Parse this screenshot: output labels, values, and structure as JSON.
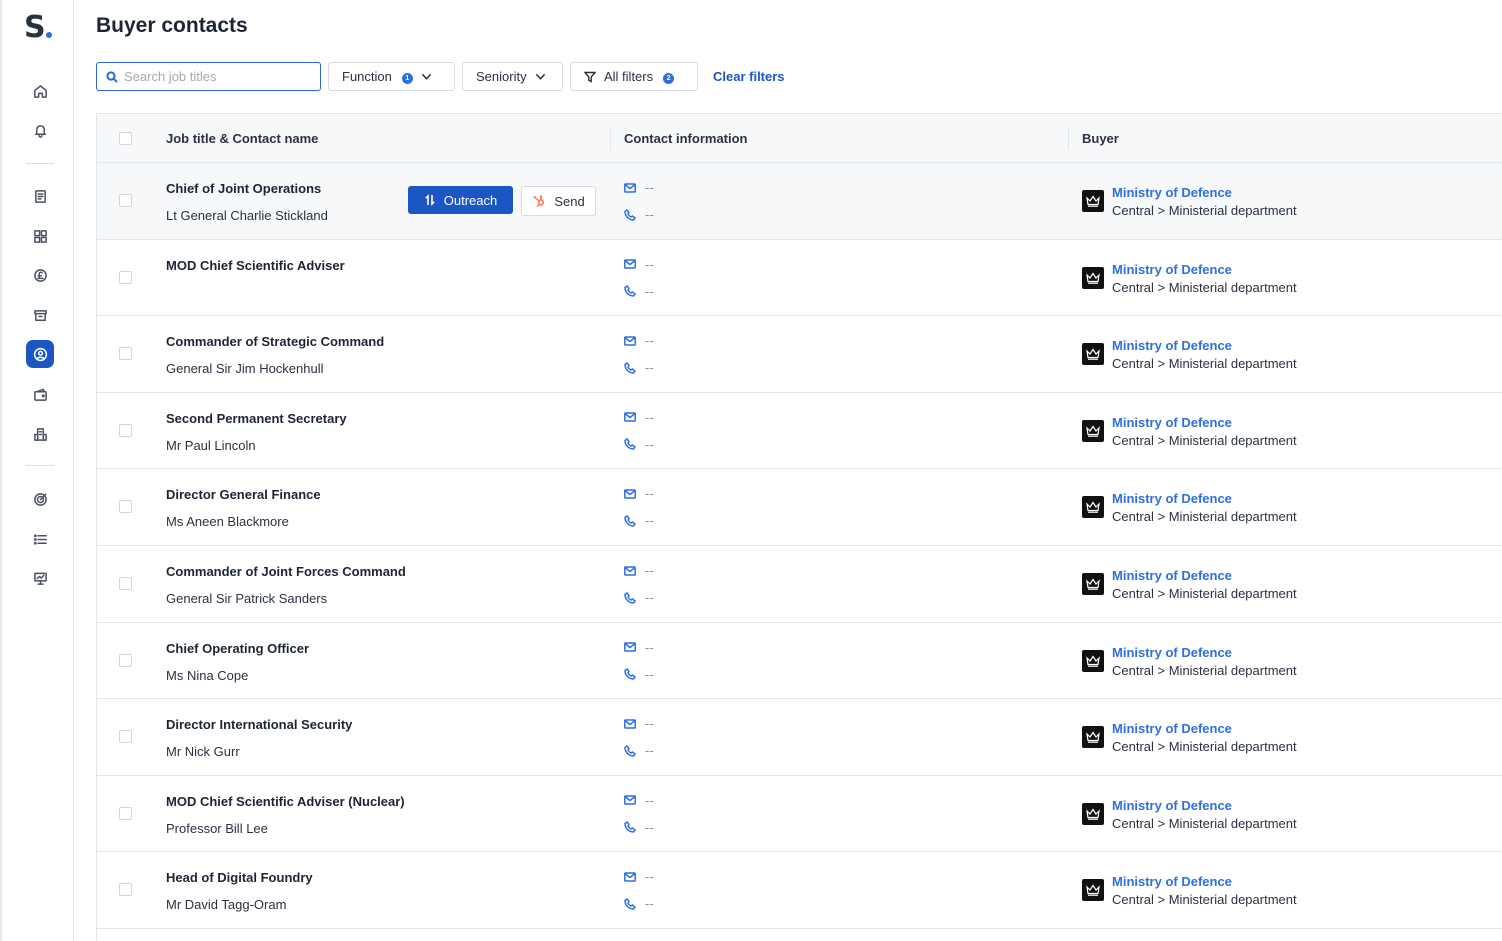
{
  "app": {
    "logo_text": "S",
    "nav": [
      {
        "icon": "home-icon",
        "active": false
      },
      {
        "icon": "bell-icon",
        "active": false
      },
      {
        "icon": "document-icon",
        "active": false
      },
      {
        "icon": "grid-icon",
        "active": false
      },
      {
        "icon": "pound-icon",
        "active": false
      },
      {
        "icon": "archive-icon",
        "active": false
      },
      {
        "icon": "user-circle-icon",
        "active": true
      },
      {
        "icon": "wallet-icon",
        "active": false
      },
      {
        "icon": "building-icon",
        "active": false
      },
      {
        "icon": "target-icon",
        "active": false
      },
      {
        "icon": "list-icon",
        "active": false
      },
      {
        "icon": "presentation-icon",
        "active": false
      }
    ]
  },
  "page": {
    "title": "Buyer contacts"
  },
  "filters": {
    "search_placeholder": "Search job titles",
    "search_value": "",
    "function_label": "Function",
    "function_count": "1",
    "seniority_label": "Seniority",
    "all_filters_label": "All filters",
    "all_filters_count": "2",
    "clear_label": "Clear filters"
  },
  "table": {
    "headers": {
      "job_title": "Job title & Contact name",
      "contact": "Contact information",
      "buyer": "Buyer"
    },
    "row_actions": {
      "outreach_label": "Outreach",
      "send_label": "Send"
    },
    "rows": [
      {
        "title": "Chief of Joint Operations",
        "name": "Lt General Charlie Stickland",
        "email": "--",
        "phone": "--",
        "buyer": "Ministry of Defence",
        "buyer_type": "Central > Ministerial department"
      },
      {
        "title": "MOD Chief Scientific Adviser",
        "name": "",
        "email": "--",
        "phone": "--",
        "buyer": "Ministry of Defence",
        "buyer_type": "Central > Ministerial department"
      },
      {
        "title": "Commander of Strategic Command",
        "name": "General Sir Jim Hockenhull",
        "email": "--",
        "phone": "--",
        "buyer": "Ministry of Defence",
        "buyer_type": "Central > Ministerial department"
      },
      {
        "title": "Second Permanent Secretary",
        "name": "Mr Paul Lincoln",
        "email": "--",
        "phone": "--",
        "buyer": "Ministry of Defence",
        "buyer_type": "Central > Ministerial department"
      },
      {
        "title": "Director General Finance",
        "name": "Ms Aneen Blackmore",
        "email": "--",
        "phone": "--",
        "buyer": "Ministry of Defence",
        "buyer_type": "Central > Ministerial department"
      },
      {
        "title": "Commander of Joint Forces Command",
        "name": "General Sir Patrick Sanders",
        "email": "--",
        "phone": "--",
        "buyer": "Ministry of Defence",
        "buyer_type": "Central > Ministerial department"
      },
      {
        "title": "Chief Operating Officer",
        "name": "Ms Nina Cope",
        "email": "--",
        "phone": "--",
        "buyer": "Ministry of Defence",
        "buyer_type": "Central > Ministerial department"
      },
      {
        "title": "Director International Security",
        "name": "Mr Nick Gurr",
        "email": "--",
        "phone": "--",
        "buyer": "Ministry of Defence",
        "buyer_type": "Central > Ministerial department"
      },
      {
        "title": "MOD Chief Scientific Adviser (Nuclear)",
        "name": "Professor Bill Lee",
        "email": "--",
        "phone": "--",
        "buyer": "Ministry of Defence",
        "buyer_type": "Central > Ministerial department"
      },
      {
        "title": "Head of Digital Foundry",
        "name": "Mr David Tagg-Oram",
        "email": "--",
        "phone": "--",
        "buyer": "Ministry of Defence",
        "buyer_type": "Central > Ministerial department"
      }
    ]
  }
}
